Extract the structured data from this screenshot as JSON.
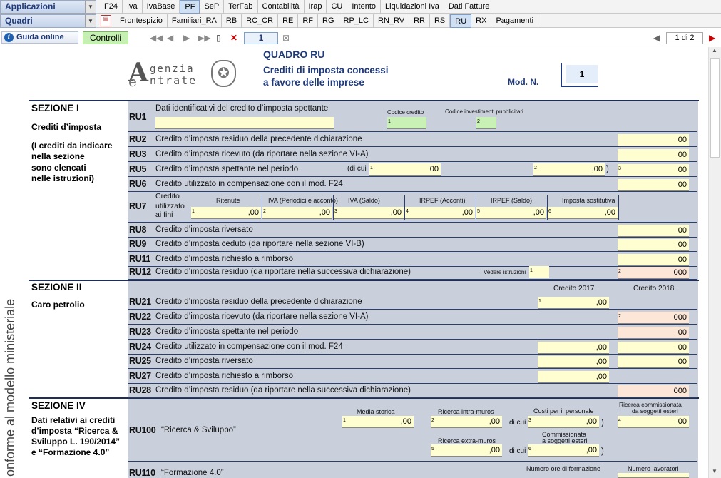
{
  "toolbar1": {
    "combo": "Applicazioni",
    "tabs": [
      "F24",
      "Iva",
      "IvaBase",
      "PF",
      "SeP",
      "TerFab",
      "Contabilità",
      "Irap",
      "CU",
      "Intento",
      "Liquidazioni Iva",
      "Dati Fatture"
    ],
    "selected": "PF"
  },
  "toolbar2": {
    "combo": "Quadri",
    "tabs": [
      "Frontespizio",
      "Familiari_RA",
      "RB",
      "RC_CR",
      "RE",
      "RF",
      "RG",
      "RP_LC",
      "RN_RV",
      "RR",
      "RS",
      "RU",
      "RX",
      "Pagamenti"
    ],
    "selected": "RU"
  },
  "toolbar3": {
    "guida": "Guida online",
    "controlli": "Controlli",
    "page_current": "1",
    "page_of": "1 di 2"
  },
  "logo": {
    "line1": "genzia",
    "line2": "ntrate"
  },
  "header": {
    "title": "QUADRO RU",
    "subtitle1": "Crediti di imposta concessi",
    "subtitle2": "a favore delle imprese",
    "mod_label": "Mod. N.",
    "mod_value": "1"
  },
  "vertical_text": "onforme al modello ministeriale",
  "sec1": {
    "title": "SEZIONE I",
    "sub1": "Crediti d’imposta",
    "sub2": "(I crediti da indicare",
    "sub3": "nella sezione",
    "sub4": "sono elencati",
    "sub5": "nelle istruzioni)"
  },
  "sec2": {
    "title": "SEZIONE II",
    "sub": "Caro petrolio",
    "col1": "Credito 2017",
    "col2": "Credito 2018"
  },
  "sec4": {
    "title": "SEZIONE IV",
    "sub1": "Dati relativi ai crediti",
    "sub2": "d’imposta “Ricerca &",
    "sub3": "Sviluppo L. 190/2014”",
    "sub4": "e “Formazione 4.0”"
  },
  "rows": {
    "RU1": {
      "code": "RU1",
      "text": "Dati identificativi del credito d’imposta spettante",
      "lbl_codice": "Codice credito",
      "lbl_invest": "Codice investimenti pubblicitari"
    },
    "RU2": {
      "code": "RU2",
      "text": "Credito d’imposta residuo della precedente dichiarazione"
    },
    "RU3": {
      "code": "RU3",
      "text": "Credito d’imposta ricevuto (da riportare nella sezione VI-A)"
    },
    "RU5": {
      "code": "RU5",
      "text": "Credito d’imposta spettante nel periodo",
      "dicui": "(di cui"
    },
    "RU6": {
      "code": "RU6",
      "text": "Credito utilizzato in compensazione con il mod. F24"
    },
    "RU7": {
      "code": "RU7",
      "text1": "Credito",
      "text2": "utilizzato",
      "text3": "ai fini",
      "c1": "Ritenute",
      "c2": "IVA (Periodici e acconto)",
      "c3": "IVA (Saldo)",
      "c4": "IRPEF (Acconti)",
      "c5": "IRPEF (Saldo)",
      "c6": "Imposta sostitutiva"
    },
    "RU8": {
      "code": "RU8",
      "text": "Credito d’imposta riversato"
    },
    "RU9": {
      "code": "RU9",
      "text": "Credito d’imposta ceduto (da riportare nella sezione VI-B)"
    },
    "RU11": {
      "code": "RU11",
      "text": "Credito d’imposta richiesto a rimborso"
    },
    "RU12": {
      "code": "RU12",
      "text": "Credito d’imposta residuo (da riportare nella successiva dichiarazione)",
      "vedere": "Vedere istruzioni"
    },
    "RU21": {
      "code": "RU21",
      "text": "Credito d’imposta residuo della precedente dichiarazione"
    },
    "RU22": {
      "code": "RU22",
      "text": "Credito d’imposta ricevuto (da riportare nella sezione VI-A)"
    },
    "RU23": {
      "code": "RU23",
      "text": "Credito d’imposta spettante nel periodo"
    },
    "RU24": {
      "code": "RU24",
      "text": "Credito utilizzato in compensazione con il mod. F24"
    },
    "RU25": {
      "code": "RU25",
      "text": "Credito d’imposta riversato"
    },
    "RU27": {
      "code": "RU27",
      "text": "Credito d’imposta richiesto a rimborso"
    },
    "RU28": {
      "code": "RU28",
      "text": "Credito d’imposta residuo (da riportare nella successiva dichiarazione)"
    },
    "RU100": {
      "code": "RU100",
      "text": "“Ricerca & Sviluppo”",
      "c1": "Media storica",
      "c2": "Ricerca intra-muros",
      "c3": "Costi per il personale",
      "c4a": "Ricerca commissionata",
      "c4b": "da soggetti esteri",
      "c5": "Ricerca extra-muros",
      "c6a": "Commissionata",
      "c6b": "a soggetti esteri",
      "dicui": "di cui ("
    },
    "RU110": {
      "code": "RU110",
      "text": "“Formazione 4.0”",
      "c1": "Numero ore di formazione",
      "c2": "Numero lavoratori"
    }
  },
  "values": {
    "zero": ",00",
    "zero3": "000",
    "zeroo": "0,00",
    "paren": ")",
    "one": "1",
    "two": "2",
    "three": "3",
    "four": "4",
    "five": "5",
    "six": "6",
    "zero_short": "00",
    "ru22": "0"
  }
}
